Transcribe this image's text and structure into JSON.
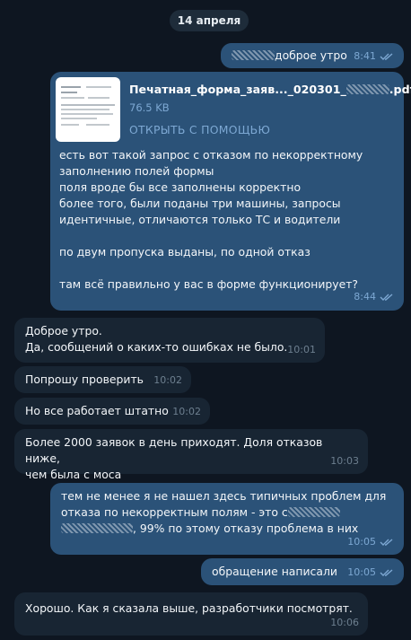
{
  "date_separator": "14 апреля",
  "messages": [
    {
      "id": "m1",
      "text": "доброе утро",
      "time": "8:41"
    },
    {
      "id": "m2",
      "file": {
        "name": "Печатная_форма_заяв..._020301_",
        "ext": ".pdf",
        "size": "76.5 KB",
        "action": "ОТКРЫТЬ С ПОМОЩЬЮ"
      },
      "lines": [
        "есть вот такой запрос с отказом по некорректному",
        "заполнению полей формы",
        "поля вроде бы все заполнены корректно",
        "более того, были поданы три машины, запросы",
        "идентичные, отличаются только ТС и водители",
        "",
        "по двум пропуска выданы, по одной отказ",
        "",
        "там всё правильно у вас в форме функционирует?"
      ],
      "time": "8:44"
    },
    {
      "id": "m3",
      "lines": [
        "Доброе утро.",
        "Да, сообщений о каких-то ошибках не было."
      ],
      "time": "10:01"
    },
    {
      "id": "m4",
      "text": "Попрошу проверить",
      "time": "10:02"
    },
    {
      "id": "m5",
      "text": "Но все работает штатно",
      "time": "10:02"
    },
    {
      "id": "m6",
      "lines": [
        "Более 2000 заявок в день приходят. Доля отказов ниже,",
        "чем была с моса"
      ],
      "time": "10:03"
    },
    {
      "id": "m7",
      "lines": [
        "тем не менее я не нашел здесь типичных проблем для",
        "отказа по некорректным полям - это с"
      ],
      "line3_suffix": ", 99% по этому отказу  проблема в них",
      "time": "10:05"
    },
    {
      "id": "m8",
      "text": "обращение написали",
      "time": "10:05"
    },
    {
      "id": "m9",
      "text": "Хорошо. Как я сказала выше, разработчики посмотрят.",
      "time": "10:06"
    }
  ],
  "colors": {
    "background": "#0e1621",
    "outgoing": "#2b5278",
    "incoming": "#182533",
    "accent": "#7da8d3"
  },
  "icons": {
    "read_receipt": "double-check-icon",
    "attachment": "pdf-file-icon"
  }
}
